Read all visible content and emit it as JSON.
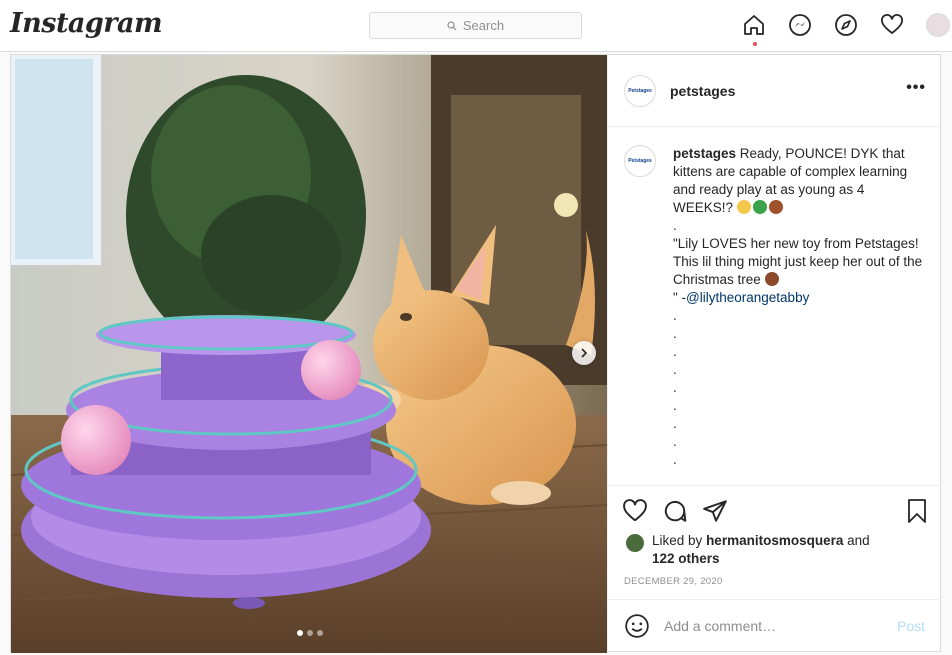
{
  "nav": {
    "logo": "Instagram",
    "search_placeholder": "Search",
    "icons": [
      "home-icon",
      "messenger-icon",
      "explore-icon",
      "activity-heart-icon",
      "profile-avatar"
    ]
  },
  "post": {
    "username": "petstages",
    "avatar_text": "Petstages",
    "caption": {
      "username": "petstages",
      "line1": "Ready, POUNCE! DYK that kittens are capable of complex learning and ready play at as young as 4 WEEKS!?",
      "line2": ".",
      "line3": "\"Lily LOVES her new toy from Petstages! This lil thing might just keep her out of the Christmas tree",
      "line4_prefix": "\" -",
      "mention": "@lilytheorangetabby",
      "dots": [
        ".",
        ".",
        ".",
        ".",
        ".",
        ".",
        ".",
        ".",
        "."
      ]
    },
    "liked_by_prefix": "Liked by",
    "liked_by_user": "hermanitosmosquera",
    "liked_by_suffix": "and",
    "others": "122 others",
    "date": "DECEMBER 29, 2020",
    "comment_placeholder": "Add a comment…",
    "post_button": "Post",
    "carousel": {
      "total": 3,
      "current": 1
    }
  },
  "colors": {
    "accent_red": "#ed4956",
    "link_blue": "#00376b",
    "post_disabled": "#b2dffc"
  }
}
